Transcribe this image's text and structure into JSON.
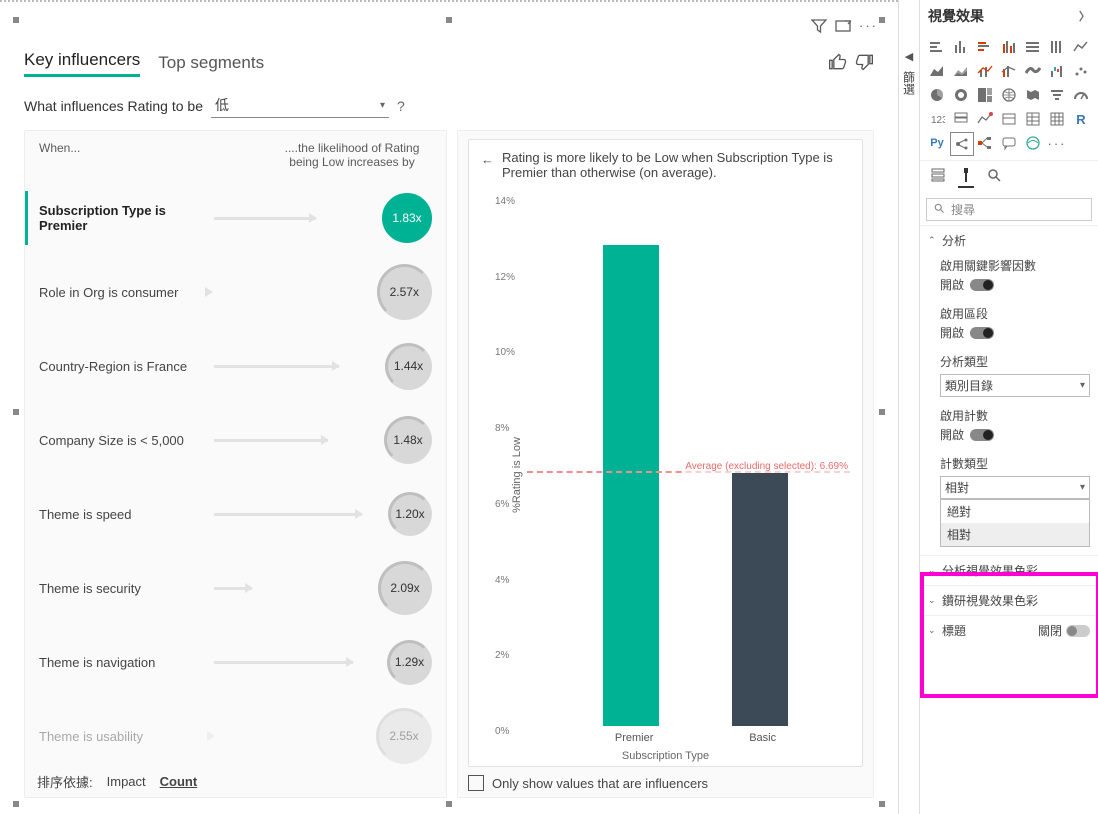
{
  "tabs": {
    "key_influencers": "Key influencers",
    "top_segments": "Top segments"
  },
  "question": {
    "prefix": "What influences Rating to be",
    "value": "低",
    "help": "?"
  },
  "left": {
    "head_left": "When...",
    "head_right": "....the likelihood of Rating being Low increases by",
    "items": [
      {
        "label": "Subscription Type is Premier",
        "value": "1.83x",
        "size": 50,
        "offset": 60,
        "selected": true
      },
      {
        "label": "Role in Org is consumer",
        "value": "2.57x",
        "size": 56,
        "offset": 160,
        "selected": false
      },
      {
        "label": "Country-Region is France",
        "value": "1.44x",
        "size": 47,
        "offset": 40,
        "selected": false
      },
      {
        "label": "Company Size is < 5,000",
        "value": "1.48x",
        "size": 48,
        "offset": 50,
        "selected": false
      },
      {
        "label": "Theme is speed",
        "value": "1.20x",
        "size": 44,
        "offset": 20,
        "selected": false
      },
      {
        "label": "Theme is security",
        "value": "2.09x",
        "size": 54,
        "offset": 120,
        "selected": false
      },
      {
        "label": "Theme is navigation",
        "value": "1.29x",
        "size": 45,
        "offset": 28,
        "selected": false
      },
      {
        "label": "Theme is usability",
        "value": "2.55x",
        "size": 56,
        "offset": 156,
        "selected": false,
        "faded": true
      }
    ],
    "sort": {
      "label": "排序依據:",
      "options": [
        "Impact",
        "Count"
      ],
      "selected": "Count"
    }
  },
  "right": {
    "title": "Rating is more likely to be Low when Subscription Type is Premier than otherwise (on average).",
    "y_label": "%Rating is Low",
    "avg_label": "Average (excluding selected): 6.69%",
    "only_influencers": "Only show values that are influencers"
  },
  "chart_data": {
    "type": "bar",
    "categories": [
      "Premier",
      "Basic"
    ],
    "values": [
      12.7,
      6.69
    ],
    "xlabel": "Subscription Type",
    "ylabel": "%Rating is Low",
    "ylim": [
      0,
      14
    ],
    "yticks": [
      0,
      2,
      4,
      6,
      8,
      10,
      12,
      14
    ],
    "colors": [
      "#00b294",
      "#3b4a56"
    ],
    "reference_line": {
      "value": 6.69,
      "label": "Average (excluding selected): 6.69%"
    }
  },
  "filter_tab": "篩選",
  "vispane": {
    "title": "視覺效果",
    "search_placeholder": "搜尋",
    "sections": {
      "analysis": "分析",
      "enable_ki": "啟用關鍵影響因數",
      "on": "開啟",
      "enable_seg": "啟用區段",
      "analysis_type": "分析類型",
      "analysis_type_value": "類別目錄",
      "enable_count": "啟用計數",
      "count_type": "計數類型",
      "count_type_value": "相對",
      "count_type_options": [
        "絕對",
        "相對"
      ],
      "analysis_colors": "分析視覺效果色彩",
      "drill_colors": "鑽研視覺效果色彩",
      "title_section": "標題",
      "off": "關閉"
    }
  }
}
